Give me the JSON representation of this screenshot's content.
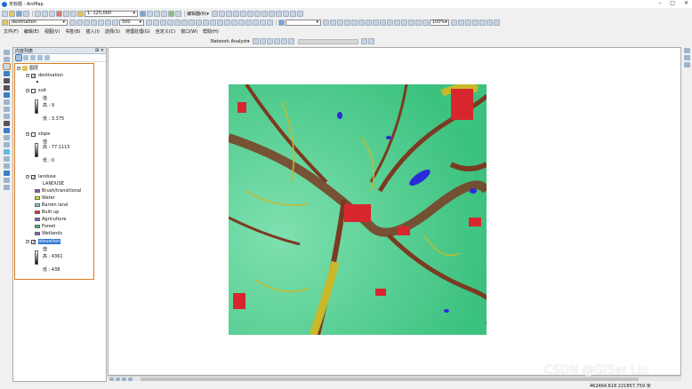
{
  "window": {
    "title": "无标题 - ArcMap"
  },
  "toolbar": {
    "scale": "1: 125,000",
    "layer_combo": "destination",
    "size_combo": "500",
    "editor_label": "编辑器(R)▾",
    "zoom_combo": "100%"
  },
  "menu": [
    "文件(F)",
    "编辑(E)",
    "视图(V)",
    "书签(B)",
    "插入(I)",
    "选择(S)",
    "地理处理(G)",
    "自定义(C)",
    "窗口(W)",
    "帮助(H)"
  ],
  "network_analyst": {
    "label": "Network Analyst▾"
  },
  "toc": {
    "title": "内容列表",
    "root": "图层",
    "layers": [
      {
        "name": "destination",
        "checked": true
      },
      {
        "name": "suit",
        "checked": false,
        "high_label": "值",
        "high": "高 : 9",
        "low": "低 : 3.375"
      },
      {
        "name": "slope",
        "checked": false,
        "high_label": "值",
        "high": "高 : 77.1115",
        "low": "低 : 0"
      },
      {
        "name": "landuse",
        "checked": true,
        "field": "LANDUSE",
        "classes": [
          {
            "label": "Brush/transitional",
            "color": "#8c4fbf"
          },
          {
            "label": "Water",
            "color": "#e6e61a"
          },
          {
            "label": "Barren land",
            "color": "#7fd0e6"
          },
          {
            "label": "Built up",
            "color": "#d8262e"
          },
          {
            "label": "Agriculture",
            "color": "#5a6ad8"
          },
          {
            "label": "Forest",
            "color": "#3fbf5a"
          },
          {
            "label": "Wetlands",
            "color": "#8a5ac8"
          }
        ]
      },
      {
        "name": "elevation",
        "checked": true,
        "selected": true,
        "high_label": "值",
        "high": "高 : 4361",
        "low": "低 : 438"
      }
    ]
  },
  "status": {
    "coords": "462464.618  221857.759 米"
  },
  "watermark": "CSDN @GISer Liu",
  "colors": {
    "accent_outline": "#e07a1d",
    "selection": "#3176d6",
    "map_green": "#4ccf8a",
    "map_brown": "#7a3b22",
    "map_red": "#d8262e",
    "map_blue": "#2b2bd8",
    "map_yellow": "#c8b82a"
  }
}
